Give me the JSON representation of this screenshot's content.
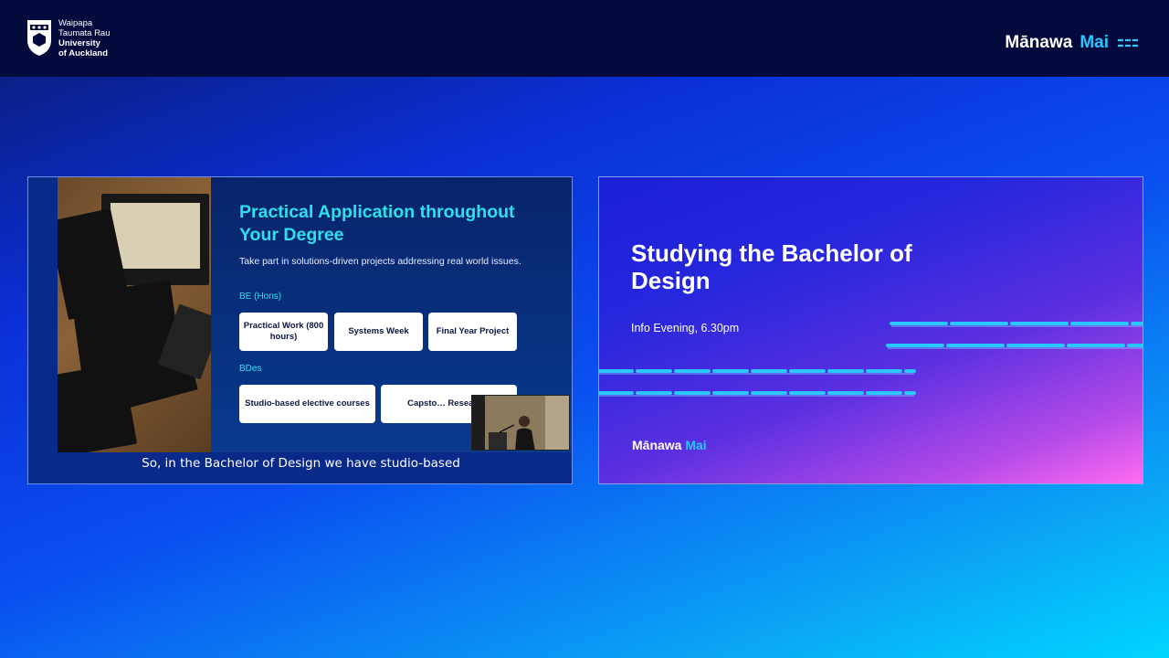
{
  "header": {
    "university_lines": [
      "Waipapa",
      "Taumata Rau",
      "University",
      "of Auckland"
    ],
    "brand_part1": "Mānawa",
    "brand_part2": "Mai"
  },
  "left_slide": {
    "title": "Practical Application throughout Your Degree",
    "subtitle": "Take part in solutions-driven projects addressing real world issues.",
    "section1_label": "BE (Hons)",
    "section1_cards": [
      "Practical Work (800 hours)",
      "Systems Week",
      "Final Year Project"
    ],
    "section2_label": "BDes",
    "section2_cards": [
      "Studio-based elective courses",
      "Capsto… Researc…"
    ],
    "caption": "So, in the Bachelor of Design we have studio-based"
  },
  "right_slide": {
    "title": "Studying the Bachelor of Design",
    "subtitle": "Info Evening, 6.30pm",
    "brand_part1": "Mānawa",
    "brand_part2": "Mai"
  },
  "colors": {
    "accent_cyan": "#2fe0ec",
    "brand_blue": "#29c6ff",
    "topbar": "#040a3c"
  }
}
